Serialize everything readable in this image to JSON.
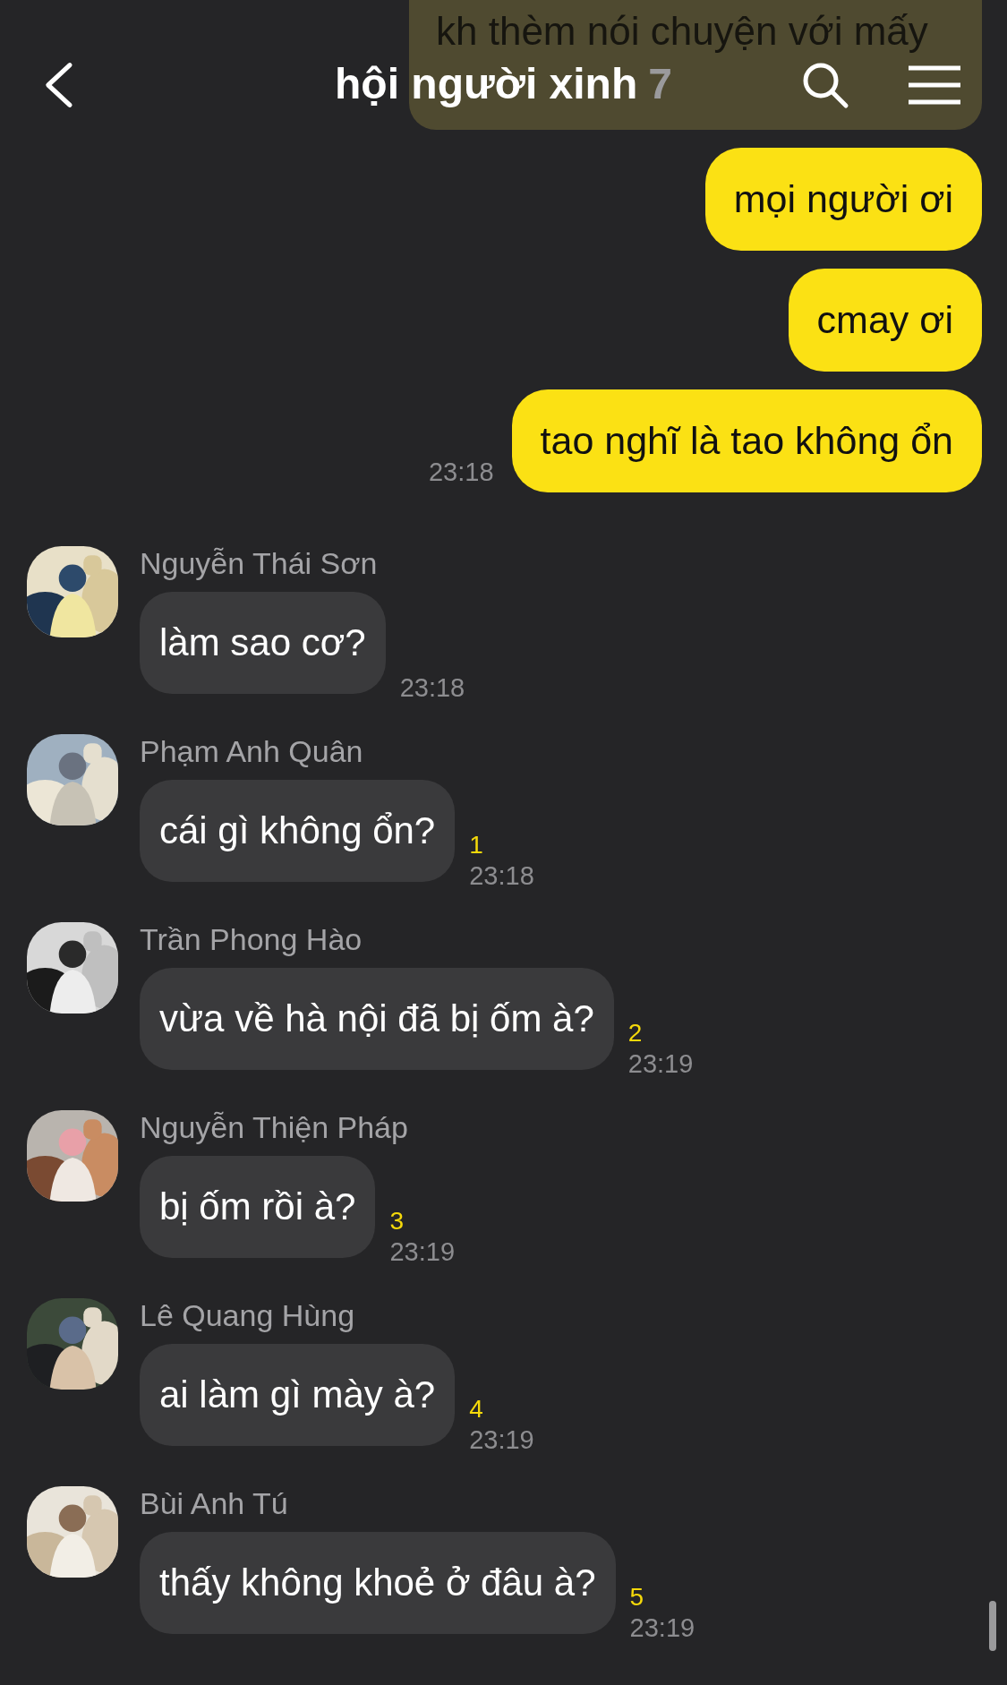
{
  "header": {
    "title": "hội người xinh",
    "member_count": "7"
  },
  "faded_message": "kh thèm nói chuyện với mấy",
  "messages": [
    {
      "kind": "sent",
      "text": "mọi người ơi"
    },
    {
      "kind": "sent",
      "text": "cmay ơi"
    },
    {
      "kind": "sent",
      "text": "tao nghĩ là tao không ổn",
      "time": "23:18"
    },
    {
      "kind": "received",
      "name": "Nguyễn Thái Sơn",
      "text": "làm sao cơ?",
      "time": "23:18"
    },
    {
      "kind": "received",
      "name": "Phạm Anh Quân",
      "text": "cái gì không ổn?",
      "read_count": "1",
      "time": "23:18"
    },
    {
      "kind": "received",
      "name": "Trần Phong Hào",
      "text": "vừa về hà nội đã bị ốm à?",
      "read_count": "2",
      "time": "23:19"
    },
    {
      "kind": "received",
      "name": "Nguyễn Thiện Pháp",
      "text": "bị ốm rồi à?",
      "read_count": "3",
      "time": "23:19"
    },
    {
      "kind": "received",
      "name": "Lê Quang Hùng",
      "text": "ai làm gì mày à?",
      "read_count": "4",
      "time": "23:19"
    },
    {
      "kind": "received",
      "name": "Bùi Anh Tú",
      "text": "thấy không khoẻ ở đâu à?",
      "read_count": "5",
      "time": "23:19"
    }
  ]
}
